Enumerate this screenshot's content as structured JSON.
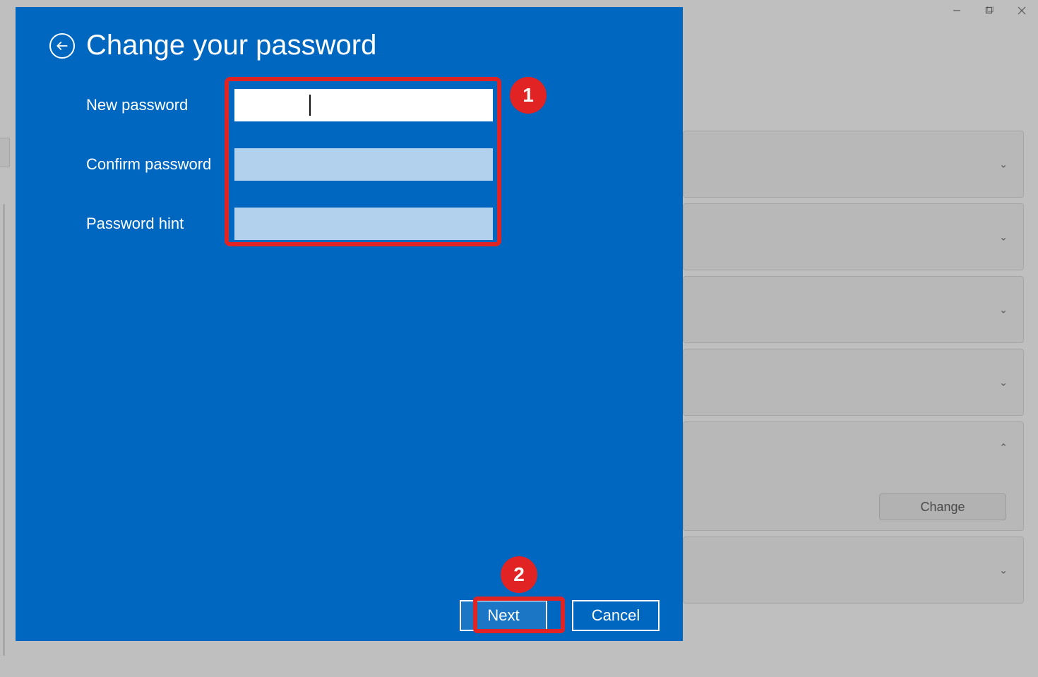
{
  "bg": {
    "change_label": "Change"
  },
  "dialog": {
    "title": "Change your password",
    "fields": {
      "new_password": {
        "label": "New password",
        "value": ""
      },
      "confirm_password": {
        "label": "Confirm password",
        "value": ""
      },
      "password_hint": {
        "label": "Password hint",
        "value": ""
      }
    },
    "actions": {
      "next": "Next",
      "cancel": "Cancel"
    }
  },
  "annotations": {
    "badge1": "1",
    "badge2": "2"
  }
}
